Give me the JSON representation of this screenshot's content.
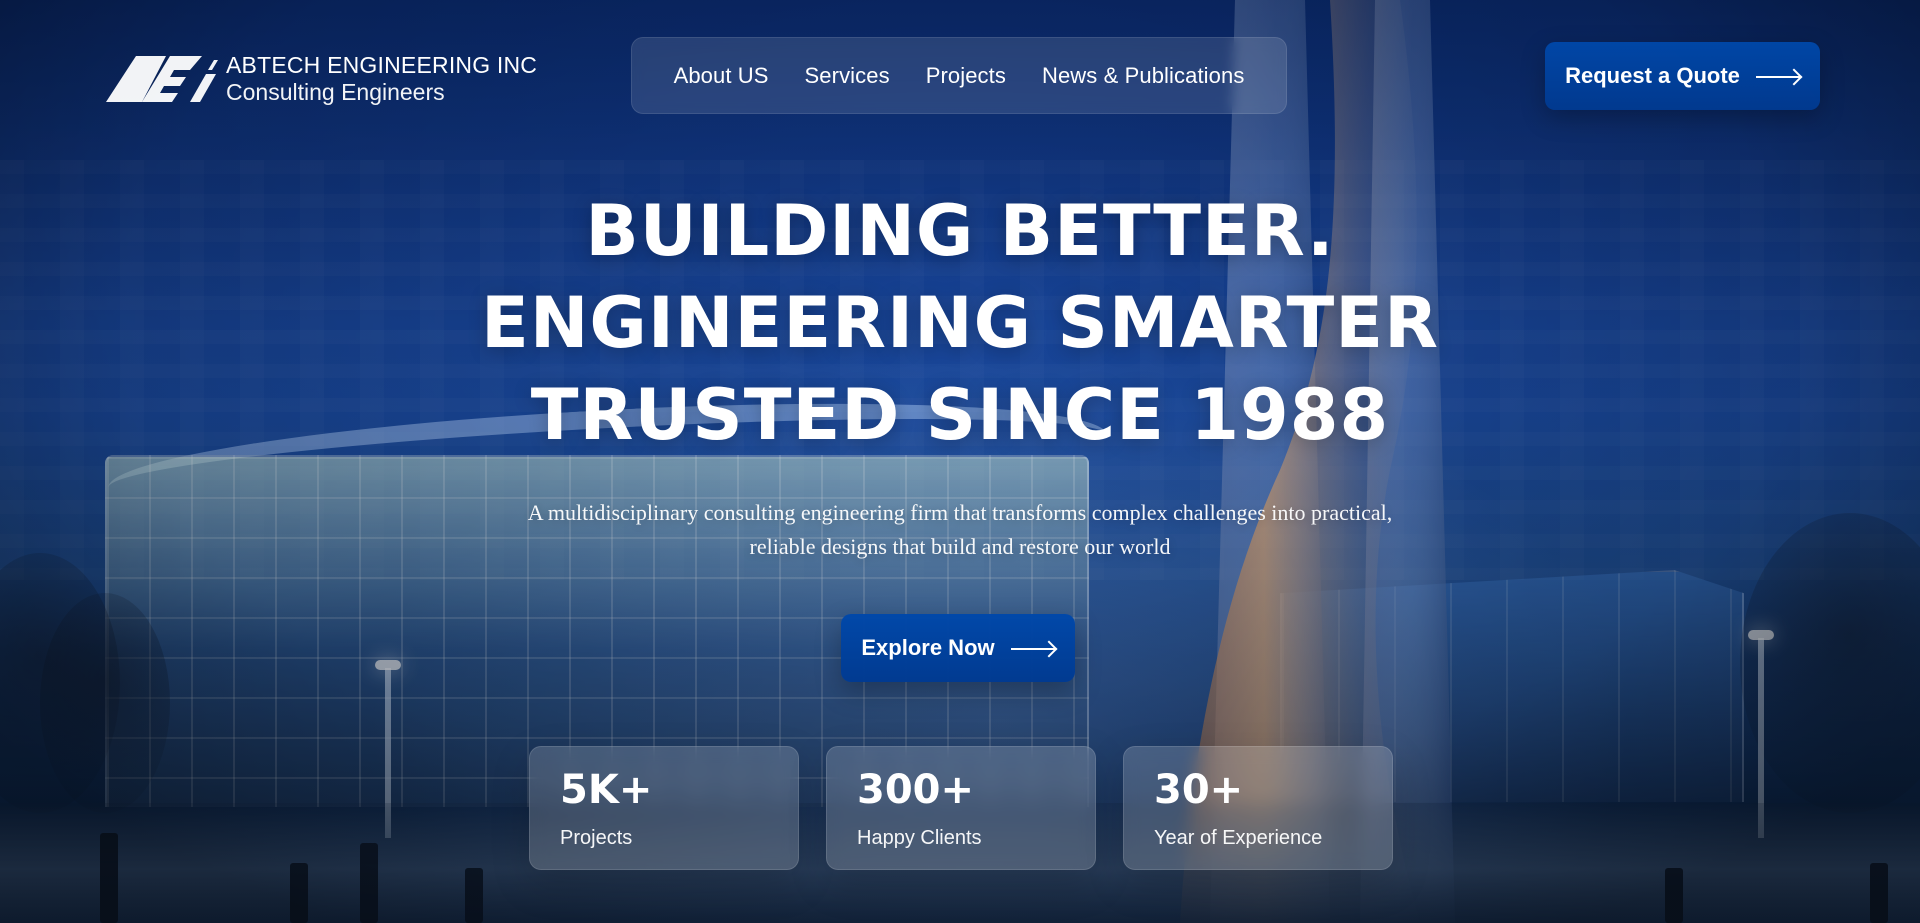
{
  "brand": {
    "logo_text": "AEi",
    "name": "ABTECH ENGINEERING INC",
    "subtitle": "Consulting Engineers"
  },
  "nav": {
    "items": [
      {
        "label": "About US"
      },
      {
        "label": "Services"
      },
      {
        "label": "Projects"
      },
      {
        "label": "News & Publications"
      }
    ]
  },
  "cta": {
    "quote_label": "Request a Quote",
    "explore_label": "Explore Now"
  },
  "hero": {
    "headline_lines": [
      "BUILDING BETTER.",
      "ENGINEERING SMARTER",
      "TRUSTED SINCE 1988"
    ],
    "description_lines": [
      "A multidisciplinary consulting engineering firm that transforms complex challenges into practical,",
      "reliable designs that build and restore our world"
    ]
  },
  "stats": [
    {
      "value": "5K+",
      "label": "Projects"
    },
    {
      "value": "300+",
      "label": "Happy Clients"
    },
    {
      "value": "30+",
      "label": "Year of Experience"
    }
  ],
  "colors": {
    "primary_button": "#0047AA",
    "hero_overlay": "#0D2F7A"
  },
  "icons": {
    "arrow": "right-arrow-icon"
  }
}
